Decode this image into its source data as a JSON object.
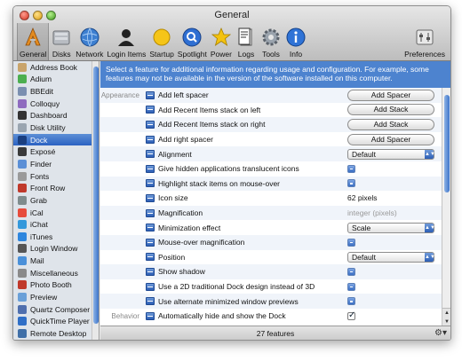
{
  "window": {
    "title": "General"
  },
  "toolbar": {
    "items": [
      {
        "label": "General",
        "icon": "general-icon",
        "selected": true
      },
      {
        "label": "Disks",
        "icon": "disks-icon"
      },
      {
        "label": "Network",
        "icon": "network-icon"
      },
      {
        "label": "Login Items",
        "icon": "login-items-icon"
      },
      {
        "label": "Startup",
        "icon": "startup-icon"
      },
      {
        "label": "Spotlight",
        "icon": "spotlight-icon"
      },
      {
        "label": "Power",
        "icon": "power-icon"
      },
      {
        "label": "Logs",
        "icon": "logs-icon"
      },
      {
        "label": "Tools",
        "icon": "tools-icon"
      },
      {
        "label": "Info",
        "icon": "info-icon"
      }
    ],
    "preferences_label": "Preferences"
  },
  "sidebar": {
    "items": [
      {
        "label": "Address Book",
        "color": "#c9a46b"
      },
      {
        "label": "Adium",
        "color": "#4caf50"
      },
      {
        "label": "BBEdit",
        "color": "#7a8fb0"
      },
      {
        "label": "Colloquy",
        "color": "#8e6bbf"
      },
      {
        "label": "Dashboard",
        "color": "#333333"
      },
      {
        "label": "Disk Utility",
        "color": "#9aa5b0"
      },
      {
        "label": "Dock",
        "color": "#2b62c2",
        "selected": true
      },
      {
        "label": "Exposé",
        "color": "#3a3a3a"
      },
      {
        "label": "Finder",
        "color": "#5b8fd6"
      },
      {
        "label": "Fonts",
        "color": "#9a9a9a"
      },
      {
        "label": "Front Row",
        "color": "#c0392b"
      },
      {
        "label": "Grab",
        "color": "#7f8c8d"
      },
      {
        "label": "iCal",
        "color": "#e74c3c"
      },
      {
        "label": "iChat",
        "color": "#3498db"
      },
      {
        "label": "iTunes",
        "color": "#2e86de"
      },
      {
        "label": "Login Window",
        "color": "#555555"
      },
      {
        "label": "Mail",
        "color": "#4a90d9"
      },
      {
        "label": "Miscellaneous",
        "color": "#8a8a8a"
      },
      {
        "label": "Photo Booth",
        "color": "#c0392b"
      },
      {
        "label": "Preview",
        "color": "#6aa0d8"
      },
      {
        "label": "Quartz Composer",
        "color": "#4f6fae"
      },
      {
        "label": "QuickTime Player",
        "color": "#2f6fc7"
      },
      {
        "label": "Remote Desktop",
        "color": "#3f6fa8"
      }
    ]
  },
  "banner": {
    "text": "Select a feature for additional information regarding usage and configuration. For example, some features may not be available in the version of the software installed on this computer."
  },
  "rows": [
    {
      "section": "Appearance",
      "label": "Add left spacer",
      "control": "button",
      "value": "Add Spacer"
    },
    {
      "section": "",
      "label": "Add Recent Items stack on left",
      "control": "button",
      "value": "Add Stack"
    },
    {
      "section": "",
      "label": "Add Recent Items stack on right",
      "control": "button",
      "value": "Add Stack"
    },
    {
      "section": "",
      "label": "Add right spacer",
      "control": "button",
      "value": "Add Spacer"
    },
    {
      "section": "",
      "label": "Alignment",
      "control": "popup",
      "value": "Default"
    },
    {
      "section": "",
      "label": "Give hidden applications translucent icons",
      "control": "checkbox-mixed",
      "value": ""
    },
    {
      "section": "",
      "label": "Highlight stack items on mouse-over",
      "control": "checkbox-mixed",
      "value": ""
    },
    {
      "section": "",
      "label": "Icon size",
      "control": "text",
      "value": "62 pixels"
    },
    {
      "section": "",
      "label": "Magnification",
      "control": "text-gray",
      "value": "integer (pixels)"
    },
    {
      "section": "",
      "label": "Minimization effect",
      "control": "popup",
      "value": "Scale"
    },
    {
      "section": "",
      "label": "Mouse-over magnification",
      "control": "checkbox-mixed",
      "value": ""
    },
    {
      "section": "",
      "label": "Position",
      "control": "popup",
      "value": "Default"
    },
    {
      "section": "",
      "label": "Show shadow",
      "control": "checkbox-mixed",
      "value": ""
    },
    {
      "section": "",
      "label": "Use a 2D traditional Dock design instead of 3D",
      "control": "checkbox-mixed",
      "value": ""
    },
    {
      "section": "",
      "label": "Use alternate minimized window previews",
      "control": "checkbox-mixed",
      "value": ""
    },
    {
      "section": "Behavior",
      "label": "Automatically hide and show the Dock",
      "control": "checkbox-checked",
      "value": ""
    }
  ],
  "status": {
    "text": "27 features"
  }
}
